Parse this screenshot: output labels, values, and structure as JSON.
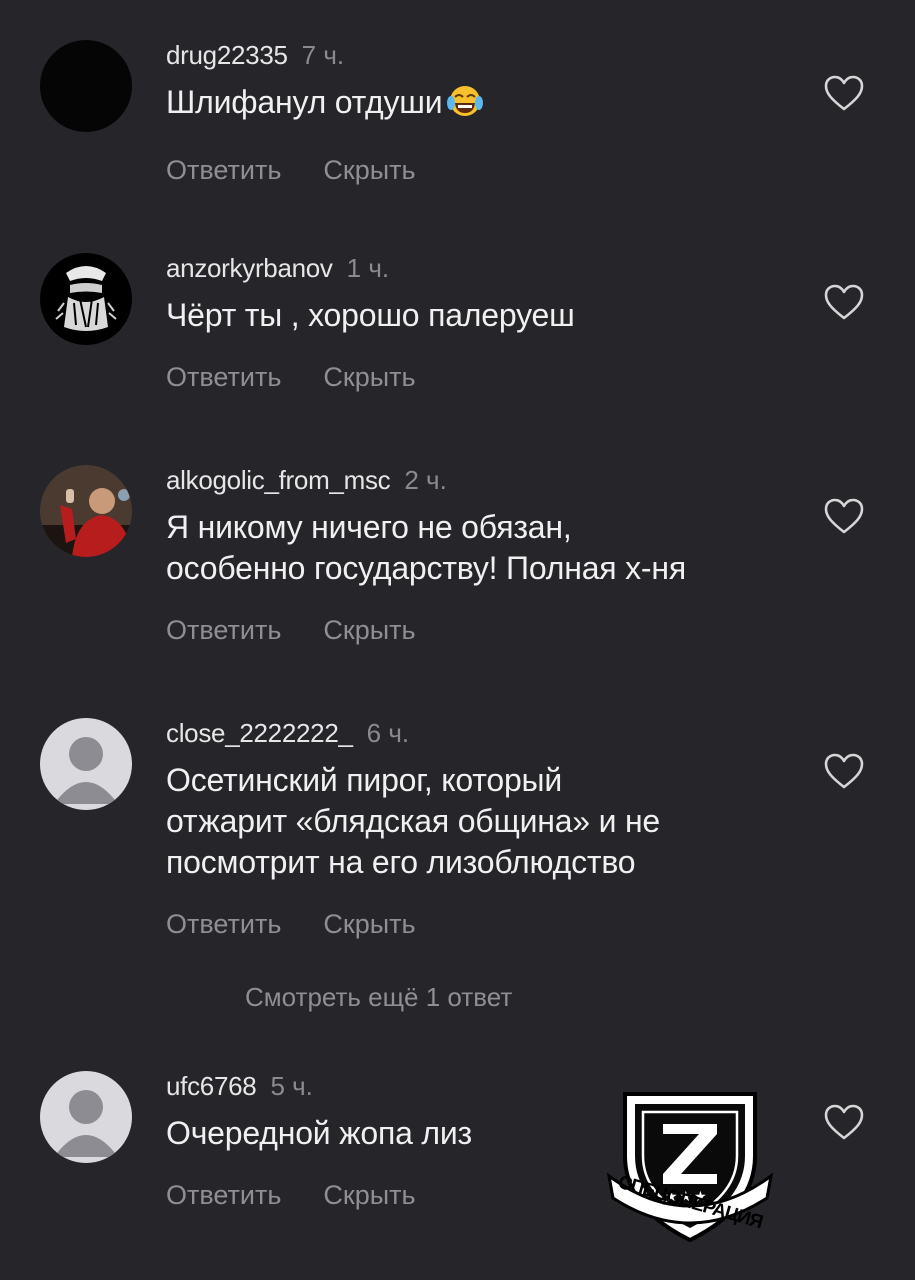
{
  "actions": {
    "reply": "Ответить",
    "hide": "Скрыть"
  },
  "comments": [
    {
      "user": "drug22335",
      "time": "7 ч.",
      "text": "Шлифанул отдуши",
      "emoji": "face-with-tears-of-joy"
    },
    {
      "user": "anzorkyrbanov",
      "time": "1 ч.",
      "text": "Чёрт ты , хорошо палеруеш"
    },
    {
      "user": "alkogolic_from_msc",
      "time": "2 ч.",
      "text_lines": [
        "Я никому ничего не обязан,",
        "особенно государству! Полная х-ня"
      ]
    },
    {
      "user": "close_2222222_",
      "time": "6 ч.",
      "text_lines": [
        "Осетинский пирог, который",
        "отжарит «блядская община» и не",
        "посмотрит на его лизоблюдство"
      ]
    },
    {
      "user": "ufc6768",
      "time": "5 ч.",
      "text": "Очередной жопа лиз"
    }
  ],
  "view_more_replies": "Смотреть ещё 1 ответ",
  "watermark": {
    "letter": "Z",
    "caption": "СПЕЦОПЕРАЦИЯ",
    "stars": "★★★"
  },
  "colors": {
    "background": "#25252a",
    "secondary_text": "#8e8e93",
    "primary_text": "#f0f0f0"
  },
  "icons": [
    "heart-outline-icon",
    "default-avatar-icon"
  ]
}
